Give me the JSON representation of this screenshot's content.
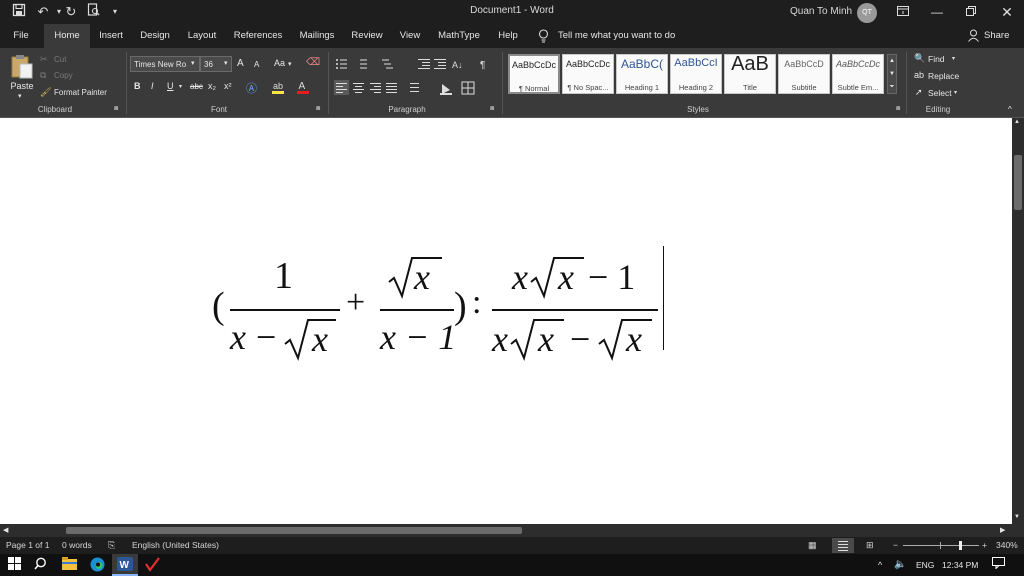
{
  "titlebar": {
    "document_title": "Document1  -  Word",
    "user_name": "Quan To Minh",
    "avatar_initials": "QT"
  },
  "menu": {
    "tabs": [
      "File",
      "Home",
      "Insert",
      "Design",
      "Layout",
      "References",
      "Mailings",
      "Review",
      "View",
      "MathType",
      "Help"
    ],
    "active_tab": "Home",
    "tell_me": "Tell me what you want to do",
    "share": "Share"
  },
  "ribbon": {
    "clipboard": {
      "label": "Clipboard",
      "paste": "Paste",
      "cut": "Cut",
      "copy": "Copy",
      "format_painter": "Format Painter"
    },
    "font": {
      "label": "Font",
      "font_name": "Times New Ro",
      "font_size": "36",
      "bold": "B",
      "italic": "I",
      "underline": "U",
      "strike": "abc",
      "subscript": "x₂",
      "superscript": "x²",
      "grow": "A",
      "shrink": "A",
      "change_case": "Aa"
    },
    "paragraph": {
      "label": "Paragraph"
    },
    "styles": {
      "label": "Styles",
      "items": [
        {
          "sample": "AaBbCcDc",
          "name": "¶ Normal"
        },
        {
          "sample": "AaBbCcDc",
          "name": "¶ No Spac..."
        },
        {
          "sample": "AaBbC(",
          "name": "Heading 1"
        },
        {
          "sample": "AaBbCcI",
          "name": "Heading 2"
        },
        {
          "sample": "AaB",
          "name": "Title"
        },
        {
          "sample": "AaBbCcD",
          "name": "Subtitle"
        },
        {
          "sample": "AaBbCcDc",
          "name": "Subtle Em..."
        }
      ]
    },
    "editing": {
      "label": "Editing",
      "find": "Find",
      "replace": "Replace",
      "select": "Select"
    }
  },
  "equation": {
    "open_paren": "(",
    "close_paren": ")",
    "plus": "+",
    "divide": ":",
    "term1_num": "1",
    "term1_den_x": "x",
    "term1_den_minus": "−",
    "term1_den_rad": "x",
    "term2_num_rad": "x",
    "term2_den": "x − 1",
    "term3_num_x": "x",
    "term3_num_rad": "x",
    "term3_num_rest": "− 1",
    "term3_den_x": "x",
    "term3_den_rad": "x",
    "term3_den_minus": "−",
    "term3_den_rad2": "x"
  },
  "status": {
    "page": "Page 1 of 1",
    "words": "0 words",
    "language": "English (United States)",
    "zoom": "340%"
  },
  "taskbar": {
    "language": "ENG",
    "time": "12:34 PM"
  }
}
